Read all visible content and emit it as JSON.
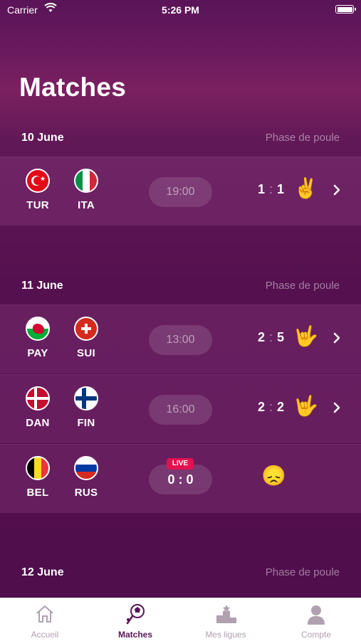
{
  "status": {
    "carrier": "Carrier",
    "time": "5:26 PM"
  },
  "page": {
    "title": "Matches"
  },
  "sections": [
    {
      "date": "10 June",
      "phase": "Phase de poule",
      "matches": [
        {
          "home": "TUR",
          "away": "ITA",
          "kickoff": "19:00",
          "pred_home": "1",
          "pred_away": "1",
          "emoji": "✌️"
        }
      ]
    },
    {
      "date": "11 June",
      "phase": "Phase de poule",
      "matches": [
        {
          "home": "PAY",
          "away": "SUI",
          "kickoff": "13:00",
          "pred_home": "2",
          "pred_away": "5",
          "emoji": "🤟"
        },
        {
          "home": "DAN",
          "away": "FIN",
          "kickoff": "16:00",
          "pred_home": "2",
          "pred_away": "2",
          "emoji": "🤟"
        },
        {
          "home": "BEL",
          "away": "RUS",
          "live": "LIVE",
          "live_score": "0 : 0",
          "emoji": "😞"
        }
      ]
    },
    {
      "date": "12 June",
      "phase": "Phase de poule",
      "matches": []
    }
  ],
  "pred_sep": ":",
  "tabs": [
    {
      "label": "Accueil",
      "icon": "home-icon"
    },
    {
      "label": "Matches",
      "icon": "soccer-ball-icon",
      "active": true
    },
    {
      "label": "Mes ligues",
      "icon": "podium-icon"
    },
    {
      "label": "Compte",
      "icon": "user-icon"
    }
  ],
  "colors": {
    "live": "#e3114f",
    "active_tab": "#5a1458",
    "inactive_tab": "#b0a0b0"
  }
}
